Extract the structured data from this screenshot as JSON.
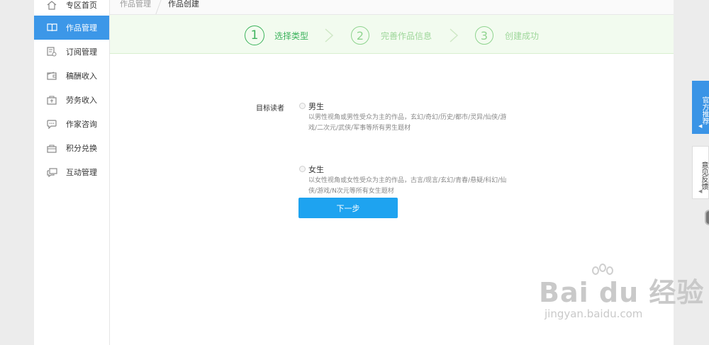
{
  "sidebar": {
    "items": [
      {
        "label": "专区首页",
        "icon": "home-icon",
        "active": false
      },
      {
        "label": "作品管理",
        "icon": "book-icon",
        "active": true
      },
      {
        "label": "订阅管理",
        "icon": "subscription-icon",
        "active": false
      },
      {
        "label": "稿酬收入",
        "icon": "wallet-icon",
        "active": false
      },
      {
        "label": "劳务收入",
        "icon": "service-income-icon",
        "active": false
      },
      {
        "label": "作家咨询",
        "icon": "chat-icon",
        "active": false
      },
      {
        "label": "积分兑换",
        "icon": "gift-box-icon",
        "active": false
      },
      {
        "label": "互动管理",
        "icon": "interaction-icon",
        "active": false
      }
    ]
  },
  "breadcrumb": {
    "parent": "作品管理",
    "current": "作品创建"
  },
  "steps": [
    {
      "number": "1",
      "label": "选择类型",
      "active": true
    },
    {
      "number": "2",
      "label": "完善作品信息",
      "active": false
    },
    {
      "number": "3",
      "label": "创建成功",
      "active": false
    }
  ],
  "form": {
    "label": "目标读者",
    "options": [
      {
        "title": "男生",
        "desc": "以男性视角或男性受众为主的作品，玄幻/奇幻/历史/都市/灵异/仙侠/游戏/二次元/武侠/军事等所有男生题材"
      },
      {
        "title": "女生",
        "desc": "以女性视角或女性受众为主的作品，古言/现言/玄幻/青春/悬疑/科幻/仙侠/游戏/N次元等所有女生题材"
      }
    ],
    "next_label": "下一步"
  },
  "float_tabs": {
    "recommend": "官方推荐",
    "feedback": "意见反馈"
  },
  "watermark": {
    "main": "Bai du 经验",
    "url": "jingyan.baidu.com"
  },
  "colors": {
    "accent": "#3c97e8",
    "button": "#1ea3f0",
    "step_active": "#3cb35c",
    "step_inactive": "#9ed79a"
  }
}
